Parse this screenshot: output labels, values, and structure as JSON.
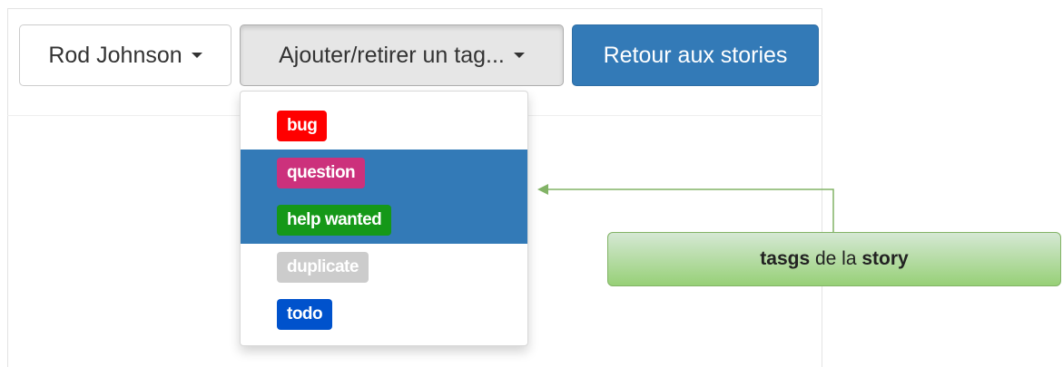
{
  "toolbar": {
    "user_button_label": "Rod Johnson",
    "tags_button_label": "Ajouter/retirer un tag...",
    "back_button_label": "Retour aux stories"
  },
  "tags_menu": {
    "items": [
      {
        "label": "bug",
        "color": "#ff0000",
        "selected": false
      },
      {
        "label": "question",
        "color": "#cc317c",
        "selected": true
      },
      {
        "label": "help wanted",
        "color": "#159818",
        "selected": true
      },
      {
        "label": "duplicate",
        "color": "#cccccc",
        "selected": false
      },
      {
        "label": "todo",
        "color": "#0052cc",
        "selected": false
      }
    ]
  },
  "callout": {
    "part1": "tasgs",
    "part2": " de la ",
    "part3": "story"
  },
  "colors": {
    "primary": "#337ab7",
    "callout_green": "#82b366"
  }
}
